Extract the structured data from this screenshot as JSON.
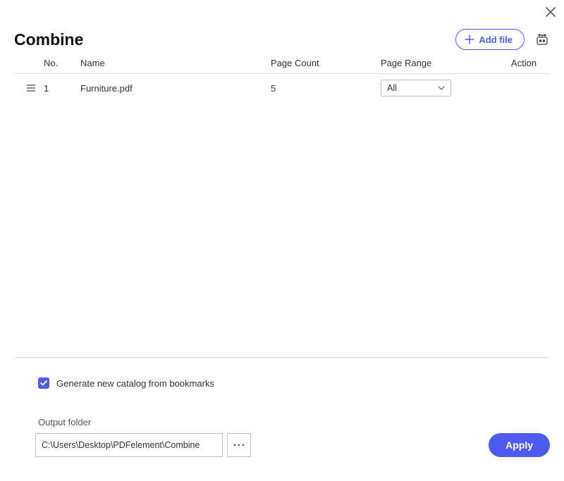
{
  "title": "Combine",
  "add_file_label": "Add file",
  "columns": {
    "no": "No.",
    "name": "Name",
    "count": "Page Count",
    "range": "Page Range",
    "action": "Action"
  },
  "rows": [
    {
      "no": "1",
      "name": "Furniture.pdf",
      "count": "5",
      "range": "All"
    }
  ],
  "generate_catalog_label": "Generate new catalog from bookmarks",
  "generate_catalog_checked": true,
  "output_folder_label": "Output folder",
  "output_folder_value": "C:\\Users\\Desktop\\PDFelement\\Combine",
  "apply_label": "Apply"
}
